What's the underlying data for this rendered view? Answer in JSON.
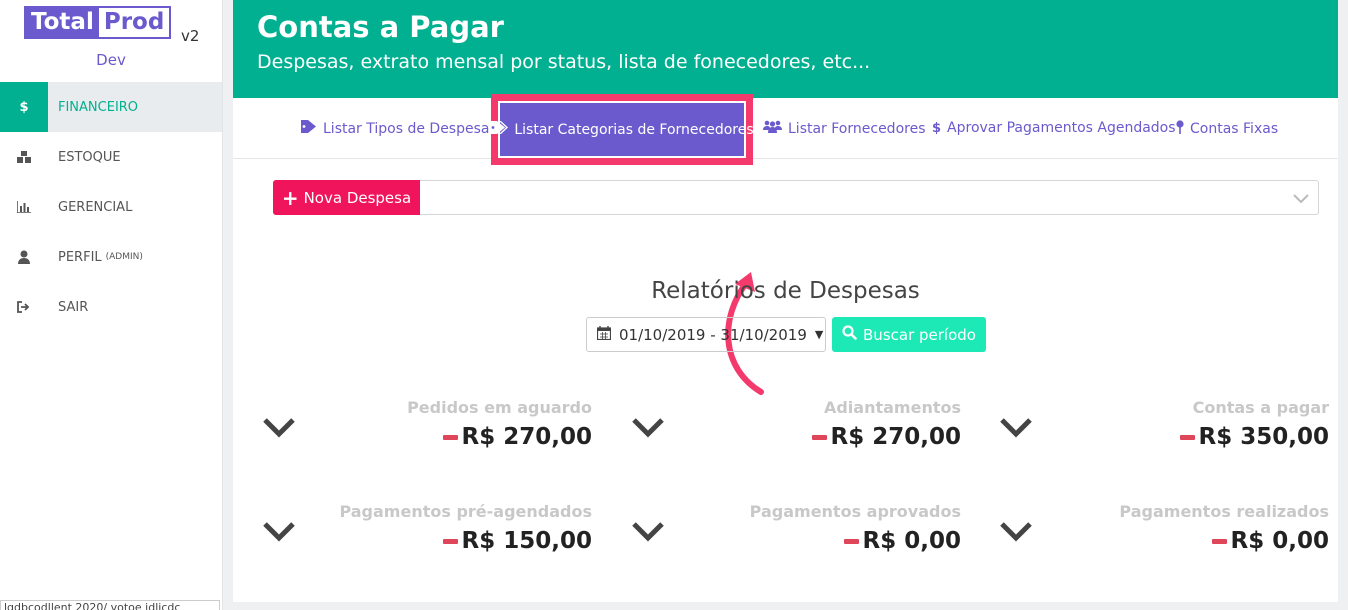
{
  "brand": {
    "part1": "Total",
    "part2": "Prod",
    "version": "v2",
    "env": "Dev"
  },
  "sidebar": {
    "items": [
      {
        "icon": "$",
        "label": "FINANCEIRO",
        "sub": ""
      },
      {
        "icon": "▞",
        "label": "ESTOQUE",
        "sub": ""
      },
      {
        "icon": "▥",
        "label": "GERENCIAL",
        "sub": ""
      },
      {
        "icon": "●",
        "label": "PERFIL",
        "sub": "(ADMIN)"
      },
      {
        "icon": "➜",
        "label": "SAIR",
        "sub": ""
      }
    ],
    "footer": "lgdbcodllent 2020/ votoe idlicdc"
  },
  "header": {
    "title": "Contas a Pagar",
    "subtitle": "Despesas, extrato mensal por status, lista de fonecedores, etc..."
  },
  "tabs": [
    {
      "label": "Listar Tipos de Despesas",
      "icon": "tag-icon"
    },
    {
      "label": "Listar Categorias de Fornecedores",
      "icon": "tags-icon"
    },
    {
      "label": "Listar Fornecedores",
      "icon": "users-icon"
    },
    {
      "label": "Aprovar Pagamentos Agendados",
      "icon": "dollar-icon"
    },
    {
      "label": "Contas Fixas",
      "icon": "pin-icon"
    }
  ],
  "actions": {
    "new_expense": "Nova Despesa"
  },
  "report": {
    "title": "Relatórios de Despesas",
    "date_range": "01/10/2019 - 31/10/2019",
    "search_label": "Buscar período"
  },
  "stats": [
    {
      "label": "Pedidos em aguardo",
      "value": "R$ 270,00"
    },
    {
      "label": "Adiantamentos",
      "value": "R$ 270,00"
    },
    {
      "label": "Contas a pagar",
      "value": "R$ 350,00"
    },
    {
      "label": "Pagamentos pré-agendados",
      "value": "R$ 150,00"
    },
    {
      "label": "Pagamentos aprovados",
      "value": "R$ 0,00"
    },
    {
      "label": "Pagamentos realizados",
      "value": "R$ 0,00"
    }
  ],
  "colors": {
    "primary": "#00b090",
    "accent": "#6a5acd",
    "highlight": "#f43a6c",
    "danger": "#f0145c",
    "search": "#1de9b6"
  }
}
